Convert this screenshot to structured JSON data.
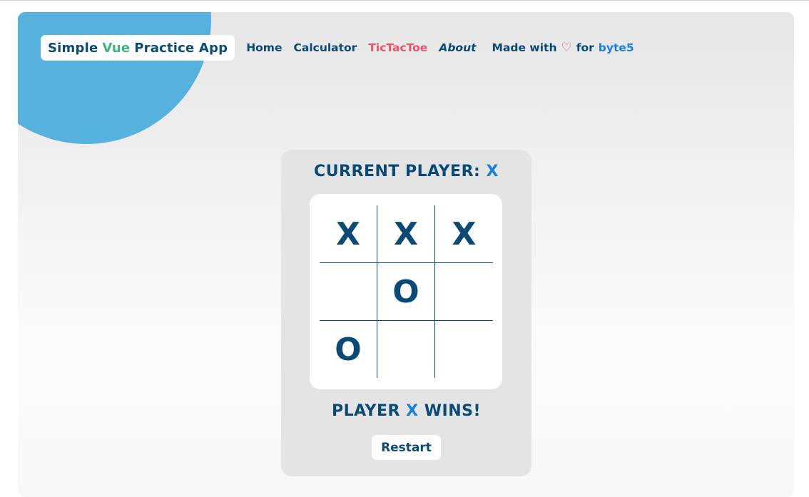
{
  "nav": {
    "brand_prefix": "Simple",
    "brand_accent": "Vue",
    "brand_suffix": "Practice App",
    "links": [
      {
        "label": "Home"
      },
      {
        "label": "Calculator"
      },
      {
        "label": "TicTacToe",
        "active": true
      },
      {
        "label": "About"
      }
    ],
    "made_with_prefix": "Made with",
    "made_with_heart": "♡",
    "made_with_for": "for",
    "made_with_link": "byte5"
  },
  "game": {
    "current_label": "CURRENT PLAYER:",
    "current_player": "X",
    "board": [
      "X",
      "X",
      "X",
      "",
      "O",
      "",
      "O",
      "",
      ""
    ],
    "status_prefix": "PLAYER",
    "status_player": "X",
    "status_suffix": "WINS!",
    "restart_label": "Restart"
  },
  "colors": {
    "navy": "#0b4a74",
    "accent_green": "#3fb27f",
    "active_pink": "#e1556f",
    "link_blue": "#1a7fd6",
    "circle_blue": "#4eaedd"
  }
}
